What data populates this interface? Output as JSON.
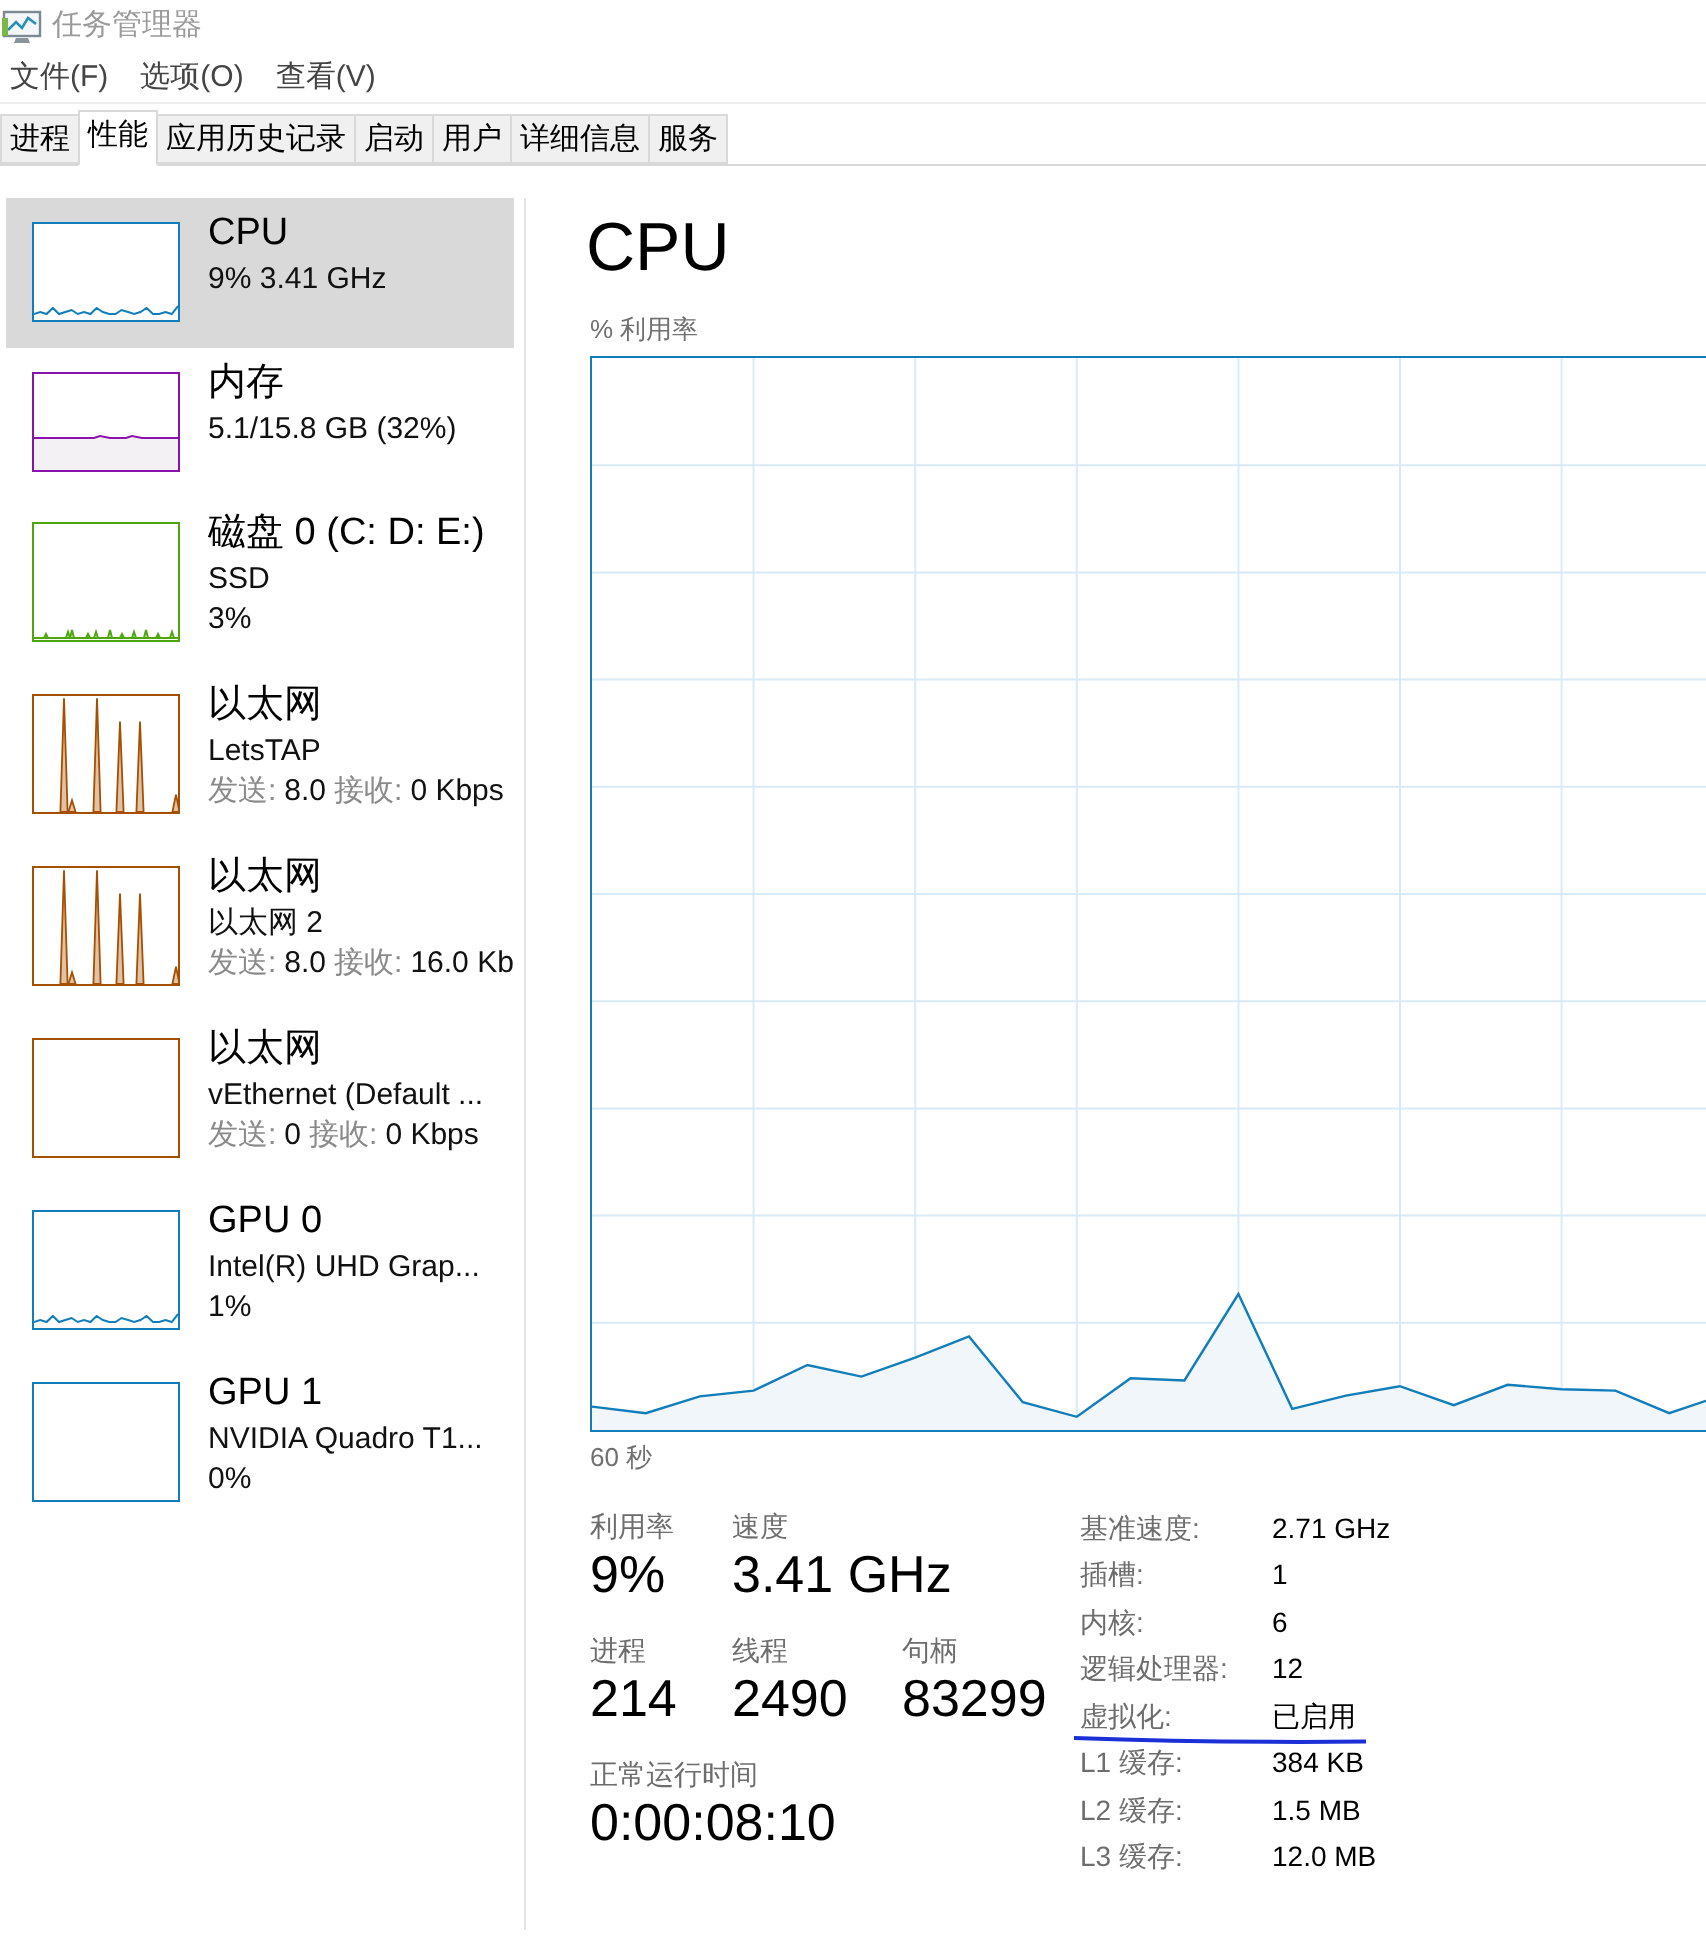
{
  "window": {
    "title": "任务管理器"
  },
  "menu": [
    "文件(F)",
    "选项(O)",
    "查看(V)"
  ],
  "tabs": [
    {
      "label": "进程",
      "selected": false
    },
    {
      "label": "性能",
      "selected": true
    },
    {
      "label": "应用历史记录",
      "selected": false
    },
    {
      "label": "启动",
      "selected": false
    },
    {
      "label": "用户",
      "selected": false
    },
    {
      "label": "详细信息",
      "selected": false
    },
    {
      "label": "服务",
      "selected": false
    }
  ],
  "sidebar": {
    "items": [
      {
        "kind": "wiggle",
        "title": "CPU",
        "subtitle": "9% 3.41 GHz",
        "color": "#117dbb",
        "selected": true
      },
      {
        "kind": "memory",
        "title": "内存",
        "subtitle": "5.1/15.8 GB (32%)",
        "color": "#8b12ae",
        "selected": false
      },
      {
        "kind": "ticks",
        "title": "磁盘 0 (C: D: E:)",
        "subtitle": "SSD",
        "detail": "3%",
        "color": "#4da60c",
        "selected": false
      },
      {
        "kind": "spikes",
        "title": "以太网",
        "subtitle": "LetsTAP",
        "traffic": {
          "send_label": "发送:",
          "send": "8.0",
          "receive_label": "接收:",
          "receive": "0 Kbps"
        },
        "color": "#a74f01",
        "selected": false
      },
      {
        "kind": "spikes",
        "title": "以太网",
        "subtitle": "以太网 2",
        "traffic": {
          "send_label": "发送:",
          "send": "8.0",
          "receive_label": "接收:",
          "receive": "16.0 Kb"
        },
        "color": "#a74f01",
        "selected": false
      },
      {
        "kind": "empty",
        "title": "以太网",
        "subtitle": "vEthernet (Default ...",
        "traffic": {
          "send_label": "发送:",
          "send": "0",
          "receive_label": "接收:",
          "receive": "0 Kbps"
        },
        "color": "#a74f01",
        "selected": false
      },
      {
        "kind": "wiggle",
        "title": "GPU 0",
        "subtitle": "Intel(R) UHD Grap...",
        "detail": "1%",
        "color": "#117dbb",
        "selected": false
      },
      {
        "kind": "empty",
        "title": "GPU 1",
        "subtitle": "NVIDIA Quadro T1...",
        "detail": "0%",
        "color": "#117dbb",
        "selected": false
      }
    ]
  },
  "main": {
    "title": "CPU",
    "graph_label": "% 利用率",
    "time_label": "60 秒",
    "stats": [
      [
        {
          "label": "利用率",
          "value": "9%"
        },
        {
          "label": "速度",
          "value": "3.41 GHz"
        }
      ],
      [
        {
          "label": "进程",
          "value": "214"
        },
        {
          "label": "线程",
          "value": "2490"
        },
        {
          "label": "句柄",
          "value": "83299"
        }
      ],
      [
        {
          "label": "正常运行时间",
          "value": "0:00:08:10"
        }
      ]
    ],
    "details": [
      {
        "label": "基准速度:",
        "value": "2.71 GHz",
        "underlined": false
      },
      {
        "label": "插槽:",
        "value": "1",
        "underlined": false
      },
      {
        "label": "内核:",
        "value": "6",
        "underlined": false
      },
      {
        "label": "逻辑处理器:",
        "value": "12",
        "underlined": false
      },
      {
        "label": "虚拟化:",
        "value": "已启用",
        "underlined": true
      },
      {
        "label": "L1 缓存:",
        "value": "384 KB",
        "underlined": false
      },
      {
        "label": "L2 缓存:",
        "value": "1.5 MB",
        "underlined": false
      },
      {
        "label": "L3 缓存:",
        "value": "12.0 MB",
        "underlined": false
      }
    ]
  }
}
